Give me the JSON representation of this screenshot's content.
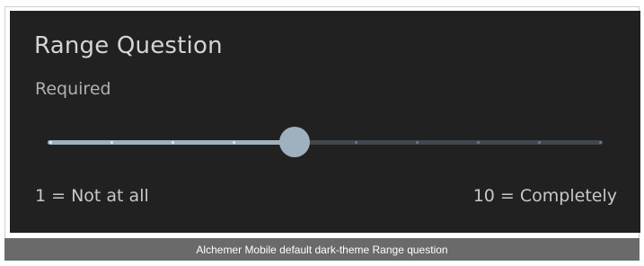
{
  "question": {
    "title": "Range Question",
    "required_label": "Required",
    "min_label": "1 = Not at all",
    "max_label": "10 = Completely"
  },
  "slider": {
    "min": 1,
    "max": 10,
    "value": 5
  },
  "caption": "Alchemer Mobile default dark-theme Range question",
  "colors": {
    "panel_background": "#212121",
    "track": "#40474d",
    "track_fill": "#9fb0bf",
    "thumb": "#9fb0bf",
    "caption_background": "#6a6a6a"
  }
}
